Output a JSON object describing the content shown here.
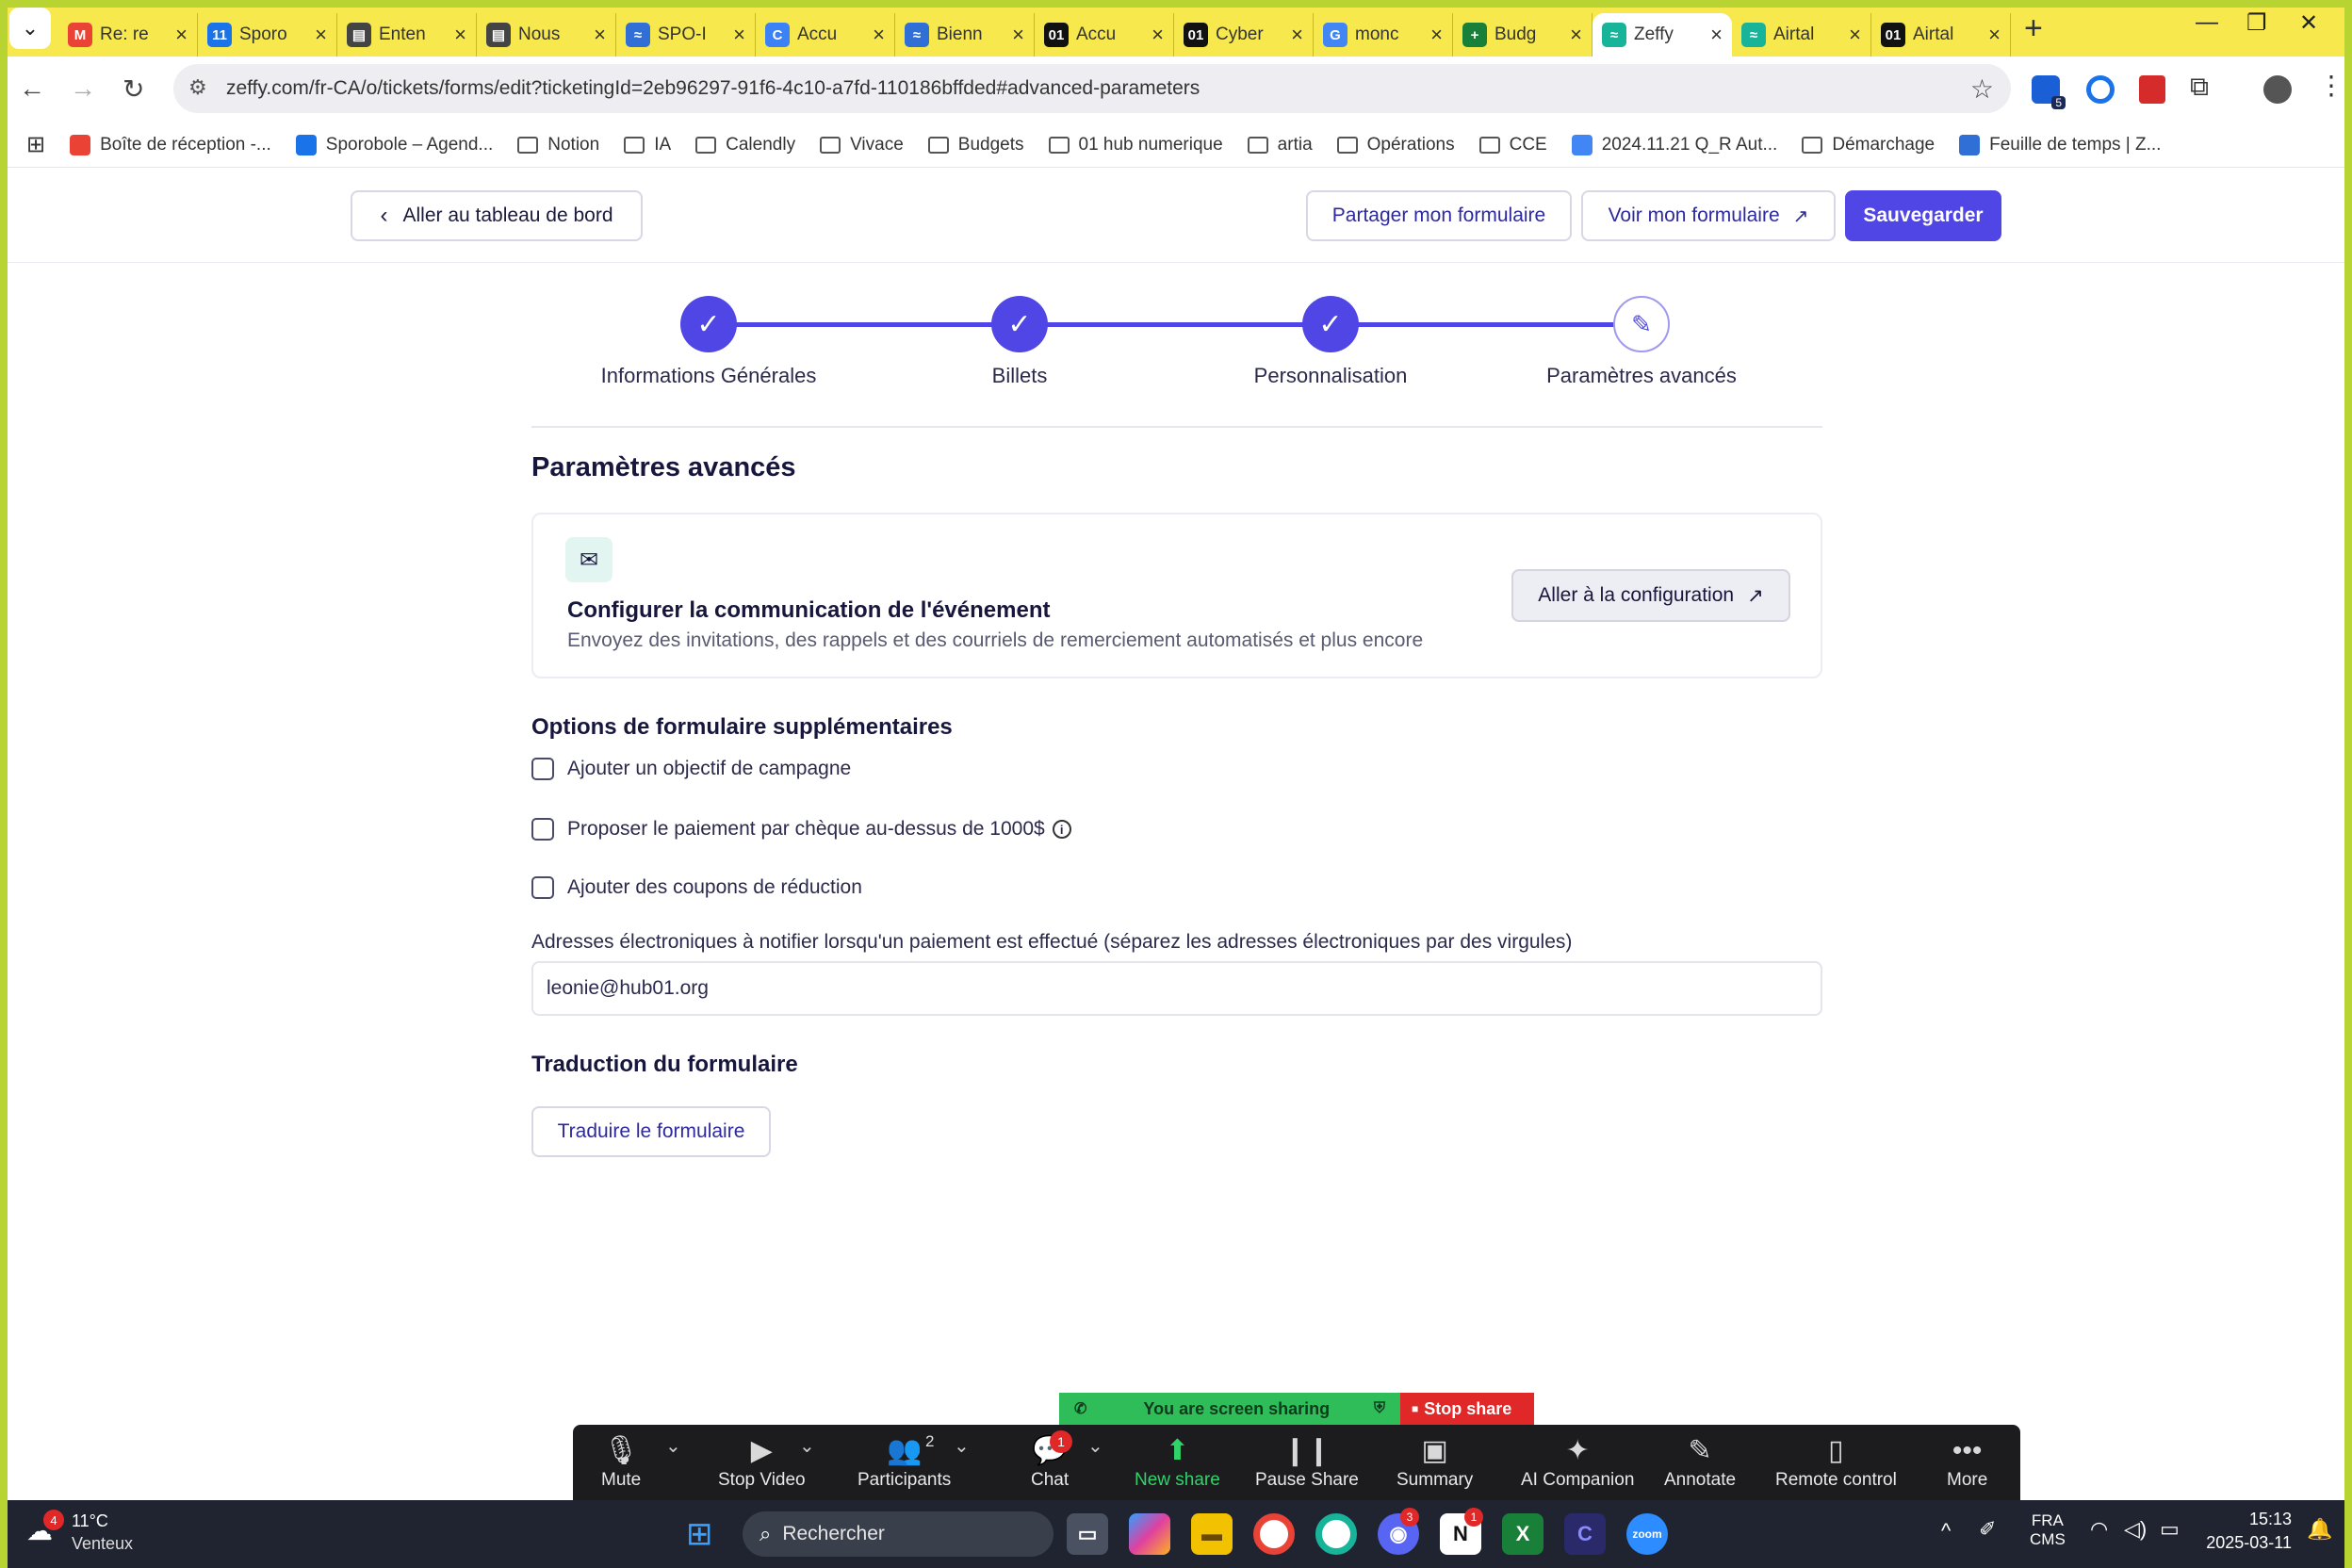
{
  "browser": {
    "tabs": [
      {
        "title": "Re: re",
        "icon": "gmail-icon",
        "color": "#ea4335",
        "glyph": "M"
      },
      {
        "title": "Sporo",
        "icon": "calendar-icon",
        "color": "#1a73e8",
        "glyph": "11"
      },
      {
        "title": "Enten",
        "icon": "film-icon",
        "color": "#444444",
        "glyph": "▤"
      },
      {
        "title": "Nous",
        "icon": "film-icon",
        "color": "#444444",
        "glyph": "▤"
      },
      {
        "title": "SPO-I",
        "icon": "zeffy-icon",
        "color": "#2f6fd6",
        "glyph": "≈"
      },
      {
        "title": "Accu",
        "icon": "canva-icon",
        "color": "#3b82f6",
        "glyph": "C"
      },
      {
        "title": "Bienn",
        "icon": "zeffy-icon",
        "color": "#2f6fd6",
        "glyph": "≈"
      },
      {
        "title": "Accu",
        "icon": "hub01-icon",
        "color": "#111111",
        "glyph": "01"
      },
      {
        "title": "Cyber",
        "icon": "hub01-icon",
        "color": "#111111",
        "glyph": "01"
      },
      {
        "title": "monc",
        "icon": "google-icon",
        "color": "#4285f4",
        "glyph": "G"
      },
      {
        "title": "Budg",
        "icon": "sheets-icon",
        "color": "#188038",
        "glyph": "+"
      },
      {
        "title": "Zeffy",
        "icon": "zeffy-icon",
        "color": "#18b49a",
        "glyph": "≈"
      },
      {
        "title": "Airtal",
        "icon": "zeffy-icon",
        "color": "#18b49a",
        "glyph": "≈"
      },
      {
        "title": "Airtal",
        "icon": "hub01-icon",
        "color": "#111111",
        "glyph": "01"
      }
    ],
    "active_tab": 11,
    "url": "zeffy.com/fr-CA/o/tickets/forms/edit?ticketingId=2eb96297-91f6-4c10-a7fd-110186bffded#advanced-parameters",
    "extension_badge": "5",
    "bookmarks": [
      {
        "label": "Boîte de réception -...",
        "type": "gmail",
        "color": "#ea4335"
      },
      {
        "label": "Sporobole – Agend...",
        "type": "calendar",
        "color": "#1a73e8"
      },
      {
        "label": "Notion",
        "type": "folder"
      },
      {
        "label": "IA",
        "type": "folder"
      },
      {
        "label": "Calendly",
        "type": "folder"
      },
      {
        "label": "Vivace",
        "type": "folder"
      },
      {
        "label": "Budgets",
        "type": "folder"
      },
      {
        "label": "01 hub numerique",
        "type": "folder"
      },
      {
        "label": "artia",
        "type": "folder"
      },
      {
        "label": "Opérations",
        "type": "folder"
      },
      {
        "label": "CCE",
        "type": "folder"
      },
      {
        "label": "2024.11.21 Q_R Aut...",
        "type": "docs",
        "color": "#4285f4"
      },
      {
        "label": "Démarchage",
        "type": "folder"
      },
      {
        "label": "Feuille de temps | Z...",
        "type": "zeffy",
        "color": "#2f6fd6"
      }
    ]
  },
  "header": {
    "back_label": "Aller au tableau de bord",
    "share_label": "Partager mon formulaire",
    "view_label": "Voir mon formulaire",
    "save_label": "Sauvegarder"
  },
  "stepper": {
    "steps": [
      {
        "label": "Informations Générales",
        "state": "done"
      },
      {
        "label": "Billets",
        "state": "done"
      },
      {
        "label": "Personnalisation",
        "state": "done"
      },
      {
        "label": "Paramètres avancés",
        "state": "current"
      }
    ]
  },
  "main": {
    "title": "Paramètres avancés",
    "communication_card": {
      "title": "Configurer la communication de l'événement",
      "description": "Envoyez des invitations, des rappels et des courriels de remerciement automatisés et plus encore",
      "button_label": "Aller à la configuration"
    },
    "options": {
      "title": "Options de formulaire supplémentaires",
      "items": [
        {
          "label": "Ajouter un objectif de campagne",
          "checked": false
        },
        {
          "label": "Proposer le paiement par chèque au-dessus de 1000$",
          "checked": false,
          "info": true
        },
        {
          "label": "Ajouter des coupons de réduction",
          "checked": false
        }
      ],
      "email_label": "Adresses électroniques à notifier lorsqu'un paiement est effectué (séparez les adresses électroniques par des virgules)",
      "email_value": "leonie@hub01.org"
    },
    "translation": {
      "title": "Traduction du formulaire",
      "button_label": "Traduire le formulaire"
    }
  },
  "zoom": {
    "sharing_text": "You are screen sharing",
    "stop_share_label": "Stop share",
    "participants_count": "2",
    "chat_badge": "1",
    "buttons": [
      {
        "label": "Mute",
        "icon": "microphone-icon"
      },
      {
        "label": "Stop Video",
        "icon": "video-icon"
      },
      {
        "label": "Participants",
        "icon": "participants-icon"
      },
      {
        "label": "Chat",
        "icon": "chat-icon"
      },
      {
        "label": "New share",
        "icon": "share-icon"
      },
      {
        "label": "Pause Share",
        "icon": "pause-icon"
      },
      {
        "label": "Summary",
        "icon": "summary-icon"
      },
      {
        "label": "AI Companion",
        "icon": "sparkle-icon"
      },
      {
        "label": "Annotate",
        "icon": "pencil-icon"
      },
      {
        "label": "Remote control",
        "icon": "mouse-icon"
      },
      {
        "label": "More",
        "icon": "more-icon"
      }
    ]
  },
  "taskbar": {
    "weather_temp": "11°C",
    "weather_desc": "Venteux",
    "weather_badge": "4",
    "search_placeholder": "Rechercher",
    "discord_badge": "3",
    "notion_badge": "1",
    "lang_top": "FRA",
    "lang_bottom": "CMS",
    "time": "15:13",
    "date": "2025-03-11"
  },
  "colors": {
    "accent": "#4f46e5",
    "tab_strip": "#f7e84e",
    "frame": "#b8d432",
    "zoom_green": "#2fbd59",
    "zoom_red": "#e02828"
  }
}
